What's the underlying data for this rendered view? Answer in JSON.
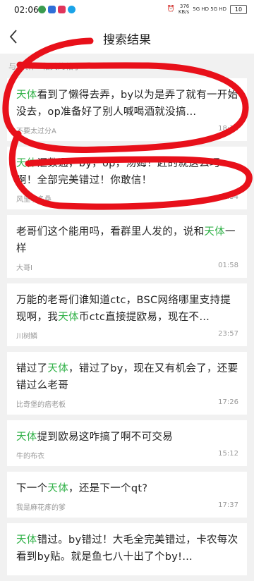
{
  "status_bar": {
    "time": "02:06",
    "net_speed_value": "376",
    "net_speed_unit": "KB/s",
    "signal": "5G HD 5G HD",
    "battery": "10"
  },
  "nav": {
    "title": "搜索结果"
  },
  "section_hint": {
    "prefix": "与",
    "keyword": "“天体”",
    "suffix": "相关的帖子"
  },
  "posts": [
    {
      "pre": "",
      "kw": "天体",
      "post": "看到了懒得去弄，by以为是弄了就有一开始没去，op准备好了别人喊喝酒就没搞…",
      "author": "不要太过分A",
      "time": "18:36"
    },
    {
      "pre": "",
      "kw": "天体",
      "post": "汇数通，by，op，汤姆！赶的就这么巧啊！全部完美错过！你敢信！",
      "author": "风里嗖多桑",
      "time": "18:34"
    },
    {
      "pre": "老哥们这个能用吗，看群里人发的，说和",
      "kw": "天体",
      "post": "一样",
      "author": "大哥I",
      "time": "01:58"
    },
    {
      "pre": "万能的老哥们谁知道ctc，BSC网络哪里支持提现啊，我",
      "kw": "天体",
      "post": "币ctc直接提欧易，现在不…",
      "author": "川树鳞",
      "time": "23:57"
    },
    {
      "pre": "错过了",
      "kw": "天体",
      "post": "，错过了by，现在又有机会了，还要错过么老哥",
      "author": "比奇堡的痞老板",
      "time": "17:26"
    },
    {
      "pre": "",
      "kw": "天体",
      "post": "提到欧易这咋搞了啊不可交易",
      "author": "牛的布衣",
      "time": "15:12"
    },
    {
      "pre": "下一个",
      "kw": "天体",
      "post": "，还是下一个qt?",
      "author": "我是麻花疼的爹",
      "time": "17:37"
    },
    {
      "pre": "",
      "kw": "天体",
      "post": "错过。by错过！大毛全完美错过，卡农每次看到by贴。就是鱼七八十出了个by!…",
      "author": "",
      "time": ""
    }
  ],
  "colors": {
    "keyword": "#33b24a",
    "annotation": "#e8101a"
  }
}
